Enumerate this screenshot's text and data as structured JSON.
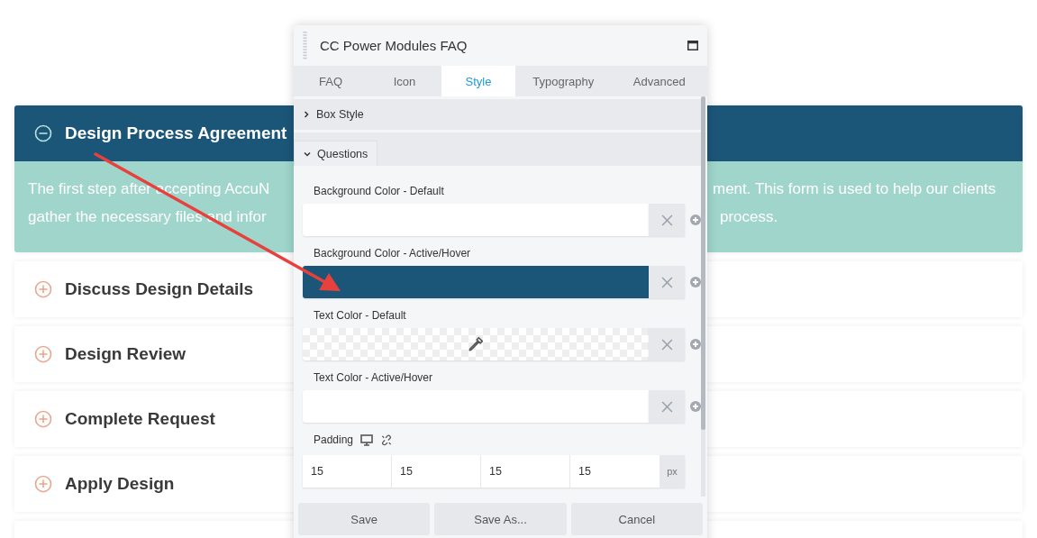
{
  "faq": [
    {
      "title": "Design Process Agreement",
      "expanded": true,
      "answer_lines": [
        {
          "left": "The first step after accepting AccuN",
          "right": "ment. This form is used to help our clients"
        },
        {
          "left": "gather the necessary files and infor",
          "right": "process."
        }
      ]
    },
    {
      "title": "Discuss Design Details",
      "expanded": false
    },
    {
      "title": "Design Review",
      "expanded": false
    },
    {
      "title": "Complete Request",
      "expanded": false
    },
    {
      "title": "Apply Design",
      "expanded": false
    }
  ],
  "panel": {
    "title": "CC Power Modules FAQ",
    "tabs": [
      {
        "label": "FAQ",
        "selected": false
      },
      {
        "label": "Icon",
        "selected": false
      },
      {
        "label": "Style",
        "selected": true
      },
      {
        "label": "Typography",
        "selected": false
      },
      {
        "label": "Advanced",
        "selected": false
      }
    ],
    "sections": [
      {
        "label": "Box Style",
        "expanded": false
      },
      {
        "label": "Questions",
        "expanded": true
      }
    ],
    "fields": [
      {
        "label": "Background Color - Default",
        "kind": "blank"
      },
      {
        "label": "Background Color - Active/Hover",
        "kind": "filled",
        "color": "#1b5678"
      },
      {
        "label": "Text Color - Default",
        "kind": "transparent"
      },
      {
        "label": "Text Color - Active/Hover",
        "kind": "blank"
      }
    ],
    "padding": {
      "label": "Padding",
      "values": [
        "15",
        "15",
        "15",
        "15"
      ],
      "unit": "px"
    },
    "buttons": [
      "Save",
      "Save As...",
      "Cancel"
    ]
  }
}
